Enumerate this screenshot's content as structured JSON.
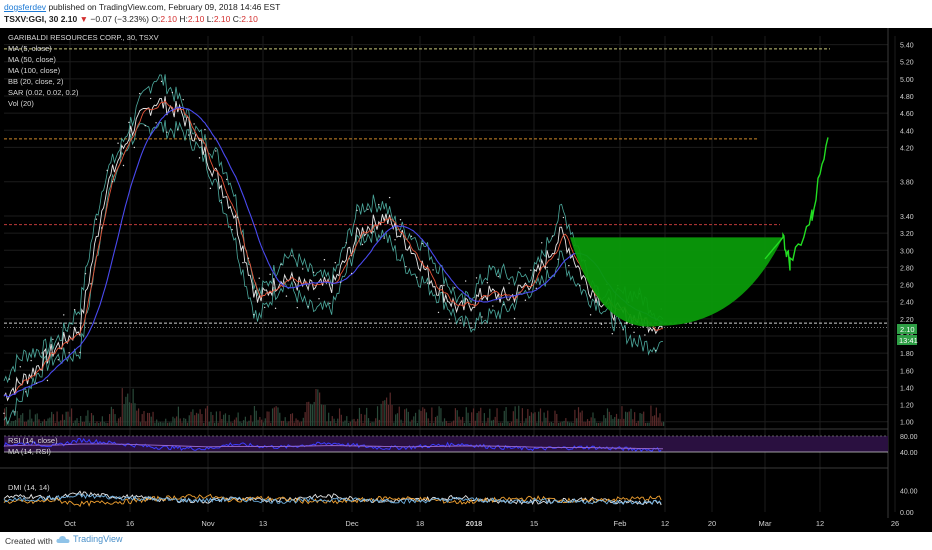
{
  "header": {
    "author": "dogsferdev",
    "published_text": "published on TradingView.com, February 09, 2018 14:46 EST",
    "symbol": "TSXV:GGI, 30",
    "last": "2.10",
    "change_arrow": "▼",
    "change": "−0.07 (−3.23%)",
    "o_label": "O:",
    "o_value": "2.10",
    "h_label": "H:",
    "h_value": "2.10",
    "l_label": "L:",
    "l_value": "2.10",
    "c_label": "C:",
    "c_value": "2.10"
  },
  "legend": [
    "GARIBALDI RESOURCES CORP., 30, TSXV",
    "MA (5, close)",
    "MA (50, close)",
    "MA (100, close)",
    "BB (20, close, 2)",
    "SAR (0.02, 0.02, 0.2)",
    "Vol (20)"
  ],
  "price_badge": "2.10",
  "time_badge": "13:41",
  "footer": {
    "created": "Created with",
    "brand": "TradingView"
  },
  "colors": {
    "background": "#000000",
    "price": "#ffffff",
    "ma5": "#e6553a",
    "ma50": "#4a4af0",
    "bb": "#5fd3c4",
    "cup": "#0a9a0a",
    "projection": "#22dd22",
    "rsi": "#3b3bff",
    "rsi_band": "#2a1040",
    "dmi_plus": "#e8e8e8",
    "dmi_minus": "#f0a030",
    "dmi_adx": "#6fb0e0",
    "badge": "#2e9e45"
  },
  "chart_data": [
    {
      "type": "line",
      "title": "GARIBALDI RESOURCES CORP., 30, TSXV",
      "x": [
        "Sep 28",
        "Oct 5",
        "Oct 12",
        "Oct 16",
        "Oct 19",
        "Oct 26",
        "Nov 2",
        "Nov 9",
        "Nov 13",
        "Nov 16",
        "Nov 20",
        "Nov 23",
        "Nov 30",
        "Dec 4",
        "Dec 8",
        "Dec 11",
        "Dec 14",
        "Dec 18",
        "Dec 22",
        "Jan 2",
        "Jan 8",
        "Jan 15",
        "Jan 19",
        "Jan 26",
        "Feb 1",
        "Feb 5",
        "Feb 9"
      ],
      "series": [
        {
          "values": [
            1.3,
            1.55,
            1.85,
            2.1,
            3.7,
            4.4,
            4.75,
            4.6,
            4.1,
            3.5,
            2.4,
            2.7,
            2.55,
            2.6,
            3.2,
            3.4,
            3.05,
            2.6,
            2.3,
            2.5,
            2.45,
            2.7,
            3.2,
            2.6,
            2.3,
            2.2,
            2.1
          ]
        }
      ],
      "projection": {
        "x": [
          "Feb 9",
          "Feb 20",
          "Mar 1",
          "Mar 5",
          "Mar 8",
          "Mar 12",
          "Mar 13"
        ],
        "values": [
          2.1,
          2.35,
          2.9,
          3.15,
          2.85,
          3.4,
          4.4
        ]
      },
      "reference_lines": [
        5.35,
        4.3,
        3.3,
        2.15
      ],
      "y_ticks": [
        1.0,
        1.2,
        1.4,
        1.6,
        1.8,
        2.0,
        2.2,
        2.4,
        2.6,
        2.8,
        3.0,
        3.2,
        3.4,
        3.8,
        4.2,
        4.4,
        4.6,
        4.8,
        5.0,
        5.2,
        5.4
      ],
      "ylim": [
        0.95,
        5.5
      ],
      "x_ticks": [
        "Oct",
        "16",
        "Nov",
        "13",
        "Dec",
        "18",
        "2018",
        "15",
        "Feb",
        "12",
        "20",
        "Mar",
        "12",
        "26"
      ]
    },
    {
      "type": "line",
      "title": "RSI (14, close)",
      "series": [
        {
          "name": "RSI (14, close)",
          "values": [
            58,
            62,
            55,
            70,
            64,
            58,
            52,
            50,
            48,
            60,
            55,
            52,
            58,
            62,
            55,
            50,
            52,
            56,
            60,
            54,
            50,
            48,
            50,
            52,
            49,
            47,
            46
          ]
        },
        {
          "name": "MA (14, RSI)",
          "values": [
            55,
            57,
            57,
            60,
            60,
            59,
            57,
            55,
            53,
            54,
            54,
            54,
            55,
            56,
            55,
            54,
            53,
            54,
            55,
            55,
            54,
            52,
            51,
            51,
            50,
            49,
            48
          ]
        }
      ],
      "y_ticks": [
        40.0,
        80.0
      ],
      "ylim": [
        30,
        90
      ]
    },
    {
      "type": "line",
      "title": "DMI (14, 14)",
      "series": [
        {
          "values": [
            28,
            30,
            25,
            35,
            30,
            28,
            24,
            22,
            20,
            26,
            22,
            24,
            28,
            30,
            24,
            20,
            22,
            25,
            28,
            22,
            20,
            18,
            22,
            24,
            20,
            18,
            17
          ]
        },
        {
          "values": [
            20,
            18,
            22,
            15,
            18,
            20,
            25,
            28,
            30,
            22,
            26,
            24,
            20,
            18,
            22,
            26,
            25,
            22,
            18,
            22,
            24,
            26,
            22,
            20,
            24,
            25,
            26
          ]
        },
        {
          "values": [
            22,
            24,
            26,
            30,
            28,
            26,
            24,
            22,
            22,
            24,
            22,
            20,
            22,
            24,
            22,
            22,
            20,
            22,
            24,
            22,
            20,
            22,
            20,
            20,
            18,
            18,
            19
          ]
        }
      ],
      "y_ticks": [
        0.0,
        40.0
      ],
      "ylim": [
        0,
        60
      ]
    }
  ]
}
